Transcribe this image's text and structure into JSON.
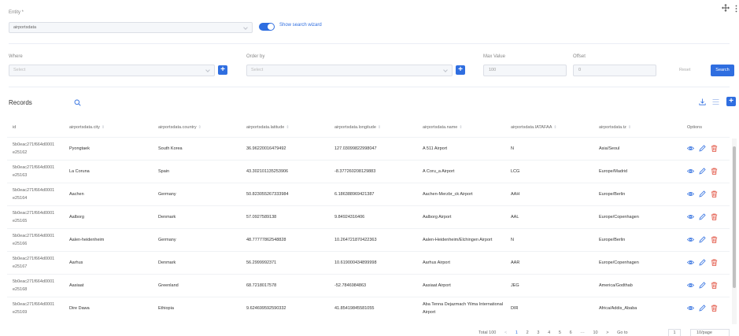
{
  "entity": {
    "label": "Entity *",
    "value": "airportsdata",
    "toggle_label": "Show search wizard",
    "toggle_on": true
  },
  "query": {
    "where_label": "Where",
    "where_placeholder": "Select",
    "order_label": "Order by",
    "order_placeholder": "Select",
    "max_label": "Max Value",
    "max_value": "100",
    "offset_label": "Offset",
    "offset_value": "0",
    "reset_label": "Reset",
    "search_label": "Search"
  },
  "records": {
    "title": "Records",
    "columns": [
      "id",
      "airportsdata.city",
      "airportsdata.country",
      "airportsdata.latitude",
      "airportsdata.longitude",
      "airportsdata.name",
      "airportsdata.IATAFAA",
      "airportsdata.tz",
      "Options"
    ],
    "rows": [
      {
        "id1": "5b0eac271f664d0001",
        "id2": "e25162",
        "city": "Pyongtaek",
        "country": "South Korea",
        "lat": "36.96220016479492",
        "lon": "127.03099822998047",
        "name": "A 511 Airport",
        "iata": "N",
        "tz": "Asia/Seoul"
      },
      {
        "id1": "5b0eac271f664d0001",
        "id2": "e25163",
        "city": "La Coruna",
        "country": "Spain",
        "lat": "43.302101135253906",
        "lon": "-8.377260208129883",
        "name": "A Coru_a Airport",
        "iata": "LCG",
        "tz": "Europe/Madrid"
      },
      {
        "id1": "5b0eac271f664d0001",
        "id2": "e25164",
        "city": "Aachen",
        "country": "Germany",
        "lat": "50.823055267333984",
        "lon": "6.186388969421387",
        "name": "Aachen-Merzbr_ck Airport",
        "iata": "AAH",
        "tz": "Europe/Berlin"
      },
      {
        "id1": "5b0eac271f664d0001",
        "id2": "e25165",
        "city": "Aalborg",
        "country": "Denmark",
        "lat": "57.0927589138",
        "lon": "9.84924316406",
        "name": "Aalborg Airport",
        "iata": "AAL",
        "tz": "Europe/Copenhagen"
      },
      {
        "id1": "5b0eac271f664d0001",
        "id2": "e25166",
        "city": "Aalen-heidenheim",
        "country": "Germany",
        "lat": "48.77777862548828",
        "lon": "10.264721870422363",
        "name": "Aalen-Heidenheim/Elchingen Airport",
        "iata": "N",
        "tz": "Europe/Berlin"
      },
      {
        "id1": "5b0eac271f664d0001",
        "id2": "e25167",
        "city": "Aarhus",
        "country": "Denmark",
        "lat": "56.2999992371",
        "lon": "10.619000434899998",
        "name": "Aarhus Airport",
        "iata": "AAR",
        "tz": "Europe/Copenhagen"
      },
      {
        "id1": "5b0eac271f664d0001",
        "id2": "e25168",
        "city": "Aasiaat",
        "country": "Greenland",
        "lat": "68.7218017578",
        "lon": "-52.7846984863",
        "name": "Aasiaat Airport",
        "iata": "JEG",
        "tz": "America/Godthab"
      },
      {
        "id1": "5b0eac271f664d0001",
        "id2": "e25169",
        "city": "Dire Dawa",
        "country": "Ethiopia",
        "lat": "9.624699592590332",
        "lon": "41.85419845581055",
        "name": "Aba Tenna Dejazmach Yilma International Airport",
        "iata": "DIR",
        "tz": "Africa/Addis_Ababa"
      }
    ]
  },
  "pagination": {
    "total": "Total 100",
    "pages": [
      "1",
      "2",
      "3",
      "4",
      "5",
      "6",
      "···",
      "10"
    ],
    "goto_label": "Go to",
    "goto_value": "1",
    "page_size": "10/page"
  },
  "colors": {
    "accent": "#2f6ee0",
    "delete": "#e04b3a"
  }
}
